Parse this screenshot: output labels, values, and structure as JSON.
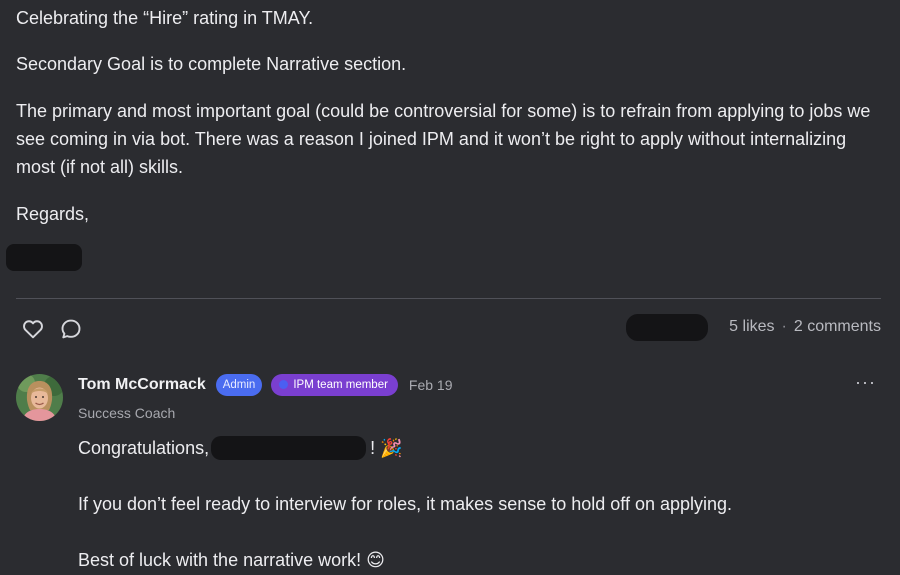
{
  "post": {
    "paragraphs": [
      "Celebrating the “Hire” rating in TMAY.",
      "Secondary Goal is to complete Narrative section.",
      "The primary and most important goal (could be controversial for some) is to refrain from applying to jobs we see coming in via bot. There was a reason I joined IPM and it won’t be right to apply without internalizing most (if not all) skills.",
      "Regards,"
    ]
  },
  "actions": {
    "like_icon": "heart-outline-icon",
    "comment_icon": "speech-bubble-icon",
    "likes_text": "5 likes",
    "separator": "·",
    "comments_text": "2 comments"
  },
  "comment": {
    "author": "Tom McCormack",
    "badges": {
      "admin": "Admin",
      "team": "IPM team member"
    },
    "date": "Feb 19",
    "role": "Success Coach",
    "more_icon": "···",
    "line1_prefix": "Congratulations,",
    "line1_suffix": "!",
    "line1_emoji": "🎉",
    "line2": "If you don’t feel ready to interview for roles, it makes sense to hold off on applying.",
    "line3_text": "Best of luck with the narrative work!",
    "line3_emoji": "😊"
  },
  "colors": {
    "background": "#2b2c30",
    "admin_badge": "#4a6cf0",
    "team_badge": "#7a3fd0",
    "redaction": "#141416"
  }
}
